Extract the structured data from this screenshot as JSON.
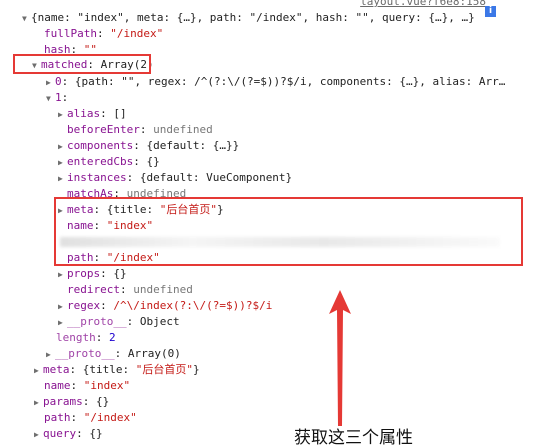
{
  "header": {
    "link": "layout.vue?f6e8:158",
    "info_icon": "i",
    "summary": "{name: \"index\", meta: {…}, path: \"/index\", hash: \"\", query: {…}, …}"
  },
  "lines": {
    "fullPath_key": "fullPath",
    "fullPath_val": "\"/index\"",
    "hash_key": "hash",
    "hash_val": "\"\"",
    "matched_key": "matched",
    "matched_val": "Array(2)",
    "m0_key": "0",
    "m0_val": "{path: \"\", regex: /^(?:\\/(?=$))?$/i, components: {…}, alias: Arr…",
    "m1_key": "1",
    "alias_key": "alias",
    "alias_val": "[]",
    "beforeEnter_key": "beforeEnter",
    "beforeEnter_val": "undefined",
    "components_key": "components",
    "components_val": "{default: {…}}",
    "enteredCbs_key": "enteredCbs",
    "enteredCbs_val": "{}",
    "instances_key": "instances",
    "instances_val": "{default: VueComponent}",
    "matchAs_key": "matchAs",
    "matchAs_val": "undefined",
    "meta_key": "meta",
    "meta_val_pre": "{title: ",
    "meta_val_str": "\"后台首页\"",
    "meta_val_post": "}",
    "name_key": "name",
    "name_val": "\"index\"",
    "path_key": "path",
    "path_val": "\"/index\"",
    "props_key": "props",
    "props_val": "{}",
    "redirect_key": "redirect",
    "redirect_val": "undefined",
    "regex_key": "regex",
    "regex_val": "/^\\/index(?:\\/(?=$))?$/i",
    "proto1_key": "__proto__",
    "proto1_val": "Object",
    "length_key": "length",
    "length_val": "2",
    "proto2_key": "__proto__",
    "proto2_val": "Array(0)",
    "tmeta_key": "meta",
    "tmeta_val_pre": "{title: ",
    "tmeta_val_str": "\"后台首页\"",
    "tmeta_val_post": "}",
    "tname_key": "name",
    "tname_val": "\"index\"",
    "params_key": "params",
    "params_val": "{}",
    "tpath_key": "path",
    "tpath_val": "\"/index\"",
    "query_key": "query",
    "query_val": "{}"
  },
  "annotation": "获取这三个属性",
  "colors": {
    "highlight": "#e53935",
    "key": "#881391",
    "string": "#c41a16",
    "number": "#1c00cf"
  }
}
